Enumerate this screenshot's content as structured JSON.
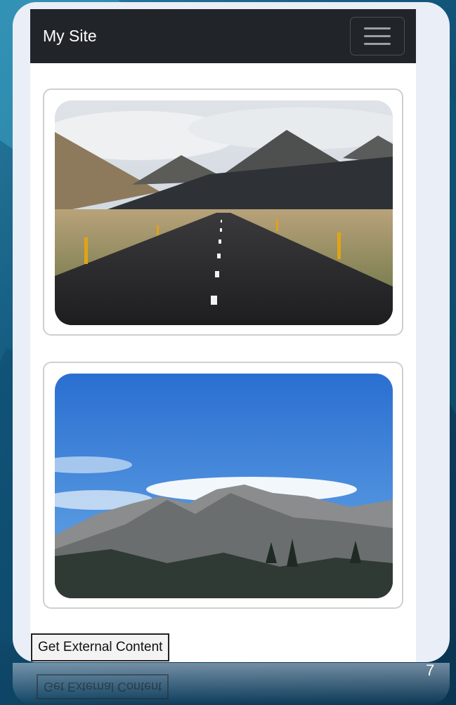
{
  "navbar": {
    "brand": "My Site",
    "toggler_icon": "hamburger-menu-icon",
    "background": "#212529"
  },
  "cards": [
    {
      "image": "road-through-mountain-valley"
    },
    {
      "image": "rocky-mountain-under-blue-sky"
    }
  ],
  "button": {
    "label": "Get External Content"
  },
  "reflection": {
    "label": "Get External Content"
  },
  "slide": {
    "number": "7"
  }
}
